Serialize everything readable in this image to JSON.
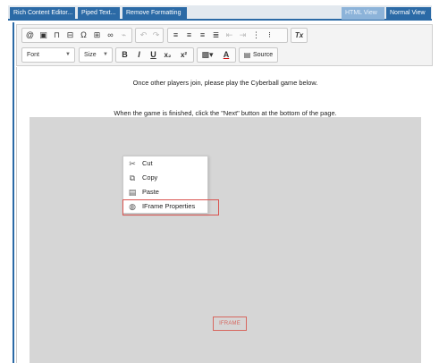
{
  "tabs": [
    {
      "label": "Rich Content Editor..."
    },
    {
      "label": "Piped Text..."
    },
    {
      "label": "Remove Formatting"
    }
  ],
  "view_toggle": {
    "html_view": "HTML View",
    "normal_view": "Normal View"
  },
  "toolbar": {
    "font_label": "Font",
    "size_label": "Size",
    "source_label": "Source",
    "bold": "B",
    "italic": "I",
    "underline": "U",
    "subscript": "x₂",
    "superscript": "x²",
    "text_color": "A",
    "remove_format": "Tx"
  },
  "content": {
    "line1": "Once other players join, please play the Cyberball game below.",
    "line2": "When the game is finished, click the \"Next\" button at the bottom of the page."
  },
  "context_menu": {
    "items": [
      {
        "label": "Cut",
        "icon": "scissors-icon"
      },
      {
        "label": "Copy",
        "icon": "copy-icon"
      },
      {
        "label": "Paste",
        "icon": "paste-icon"
      },
      {
        "label": "IFrame Properties",
        "icon": "globe-icon"
      }
    ],
    "highlighted_item": "IFrame Properties"
  },
  "iframe_placeholder": "IFRAME",
  "colors": {
    "accent": "#2b6aa6",
    "highlight_border": "#d9534f",
    "iframe_bg": "#d6d6d6"
  }
}
